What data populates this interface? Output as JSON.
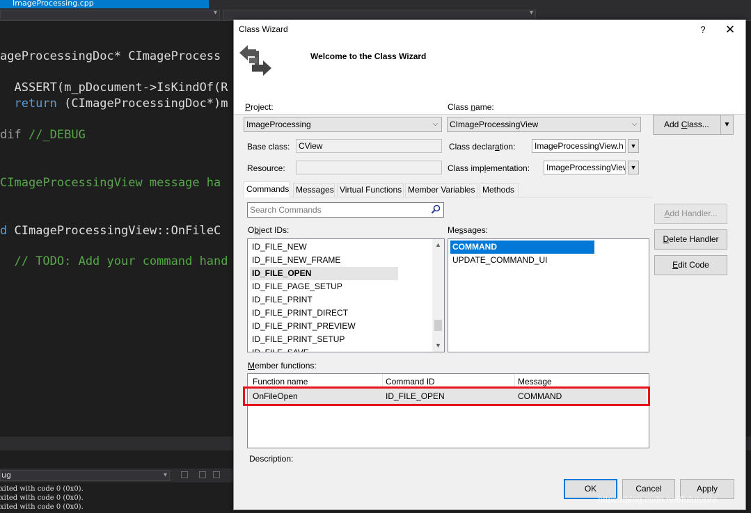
{
  "ide": {
    "tab_title": "ImageProcessing.cpp",
    "code_lines": [
      {
        "parts": [
          {
            "t": "ageProcessingDoc* CImageProcess",
            "c": "white"
          }
        ]
      },
      {
        "parts": [
          {
            "t": "  ASSERT(m_pDocument->IsKindOf(R",
            "c": "white"
          }
        ]
      },
      {
        "parts": [
          {
            "t": "  return",
            "c": "blue"
          },
          {
            "t": " (CImageProcessingDoc*)m",
            "c": "white"
          }
        ]
      },
      {
        "parts": [
          {
            "t": "dif",
            "c": "gray"
          },
          {
            "t": " //_DEBUG",
            "c": "green"
          }
        ]
      },
      {
        "parts": [
          {
            "t": "CImageProcessingView message ha",
            "c": "green"
          }
        ]
      },
      {
        "parts": [
          {
            "t": "d",
            "c": "blue"
          },
          {
            "t": " CImageProcessingView::OnFileC",
            "c": "white"
          }
        ]
      },
      {
        "parts": [
          {
            "t": "  // TODO: Add your command hand",
            "c": "green"
          }
        ]
      }
    ],
    "output_combo": "ug",
    "output_lines": [
      "xited with code 0 (0x0).",
      "xited with code 0 (0x0).",
      "xited with code 0 (0x0)."
    ]
  },
  "dialog": {
    "title": "Class Wizard",
    "help": "?",
    "close": "✕",
    "welcome": "Welcome to the Class Wizard",
    "project_label_u": "P",
    "project_label_rest": "roject:",
    "project_value": "ImageProcessing",
    "classname_label_pre": "Class ",
    "classname_label_u": "n",
    "classname_label_rest": "ame:",
    "classname_value": "CImageProcessingView",
    "add_class_pre": "Add ",
    "add_class_u": "C",
    "add_class_rest": "lass...",
    "baseclass_label": "Base class:",
    "baseclass_value": "CView",
    "classdecl_label_pre": "Class declar",
    "classdecl_label_u": "a",
    "classdecl_label_rest": "tion:",
    "classdecl_value": "ImageProcessingView.h",
    "resource_label": "Resource:",
    "resource_value": "",
    "classimpl_label_pre": "Class imp",
    "classimpl_label_u": "l",
    "classimpl_label_rest": "ementation:",
    "classimpl_value": "ImageProcessingView.cpp",
    "tabs": [
      "Commands",
      "Messages",
      "Virtual Functions",
      "Member Variables",
      "Methods"
    ],
    "search_placeholder": "Search Commands",
    "objectids_label_pre": "O",
    "objectids_label_u": "b",
    "objectids_label_rest": "ject IDs:",
    "object_ids": [
      "ID_FILE_NEW",
      "ID_FILE_NEW_FRAME",
      "ID_FILE_OPEN",
      "ID_FILE_PAGE_SETUP",
      "ID_FILE_PRINT",
      "ID_FILE_PRINT_DIRECT",
      "ID_FILE_PRINT_PREVIEW",
      "ID_FILE_PRINT_SETUP",
      "ID_FILE_SAVE"
    ],
    "messages_label_pre": "Me",
    "messages_label_u": "s",
    "messages_label_rest": "sages:",
    "messages": [
      "COMMAND",
      "UPDATE_COMMAND_UI"
    ],
    "add_handler_u": "A",
    "add_handler_rest": "dd Handler...",
    "delete_handler_u": "D",
    "delete_handler_rest": "elete Handler",
    "edit_code_u": "E",
    "edit_code_rest": "dit Code",
    "member_functions_label_u": "M",
    "member_functions_label_rest": "ember functions:",
    "grid_headers": [
      "Function name",
      "Command ID",
      "Message"
    ],
    "grid_rows": [
      {
        "fn": "OnFileOpen",
        "cmd": "ID_FILE_OPEN",
        "msg": "COMMAND"
      }
    ],
    "description_label": "Description:",
    "ok": "OK",
    "cancel": "Cancel",
    "apply": "Apply"
  },
  "watermark": "https://blog.csdn.net/fufutupre",
  "colors": {
    "highlight": "#e8121c",
    "selection": "#0078d7",
    "tab_accent": "#007acc"
  }
}
